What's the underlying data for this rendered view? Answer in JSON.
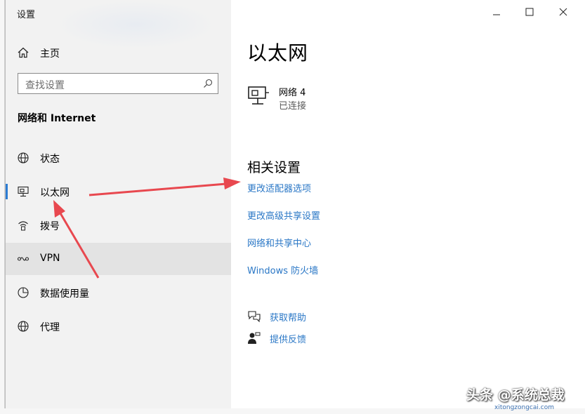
{
  "window": {
    "title": "设置"
  },
  "sidebar": {
    "home_label": "主页",
    "search_placeholder": "查找设置",
    "section_heading": "网络和 Internet",
    "items": [
      {
        "label": "状态",
        "icon": "globe-icon"
      },
      {
        "label": "以太网",
        "icon": "ethernet-icon",
        "selected": true
      },
      {
        "label": "拨号",
        "icon": "dialup-icon"
      },
      {
        "label": "VPN",
        "icon": "vpn-icon",
        "hovered": true
      },
      {
        "label": "数据使用量",
        "icon": "data-usage-icon"
      },
      {
        "label": "代理",
        "icon": "proxy-globe-icon"
      }
    ]
  },
  "main": {
    "page_title": "以太网",
    "network": {
      "name": "网络 4",
      "status": "已连接"
    },
    "related_heading": "相关设置",
    "links": [
      "更改适配器选项",
      "更改高级共享设置",
      "网络和共享中心",
      "Windows 防火墙"
    ],
    "help": {
      "get_help": "获取帮助",
      "feedback": "提供反馈"
    }
  },
  "watermark": {
    "line1": "头条 @系统总裁",
    "line2": "xitongzongcai.com"
  },
  "colors": {
    "accent": "#2b7cd3",
    "link": "#2a77c6",
    "sidebar_bg": "#f2f2f2",
    "arrow": "#e8484f"
  }
}
